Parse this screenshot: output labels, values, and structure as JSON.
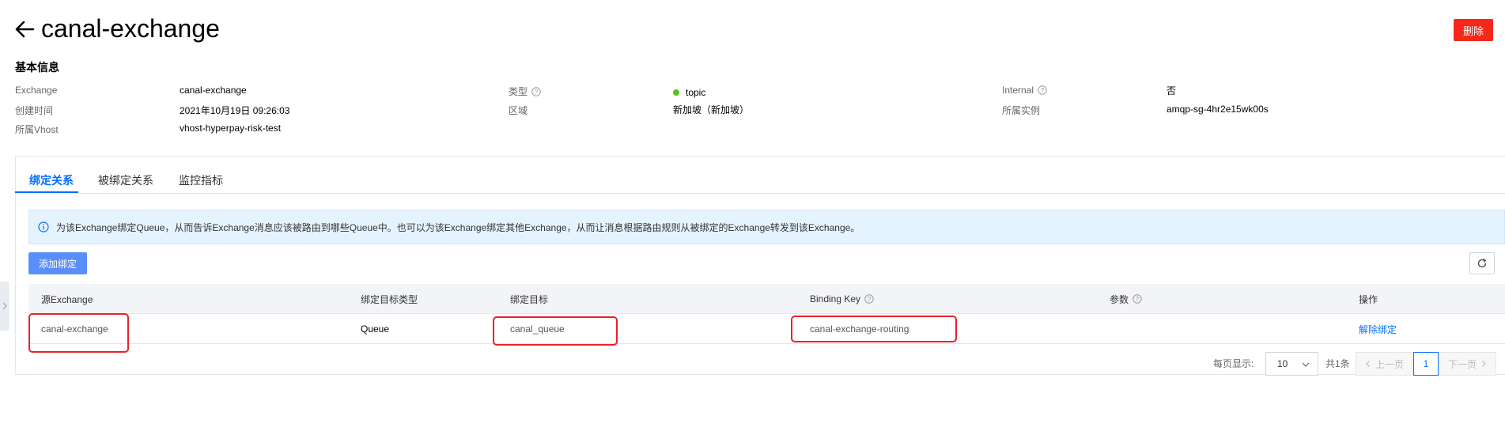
{
  "header": {
    "title": "canal-exchange",
    "delete_label": "删除"
  },
  "basic_info": {
    "section_title": "基本信息",
    "fields": [
      {
        "label": "Exchange",
        "value": "canal-exchange"
      },
      {
        "label": "创建时间",
        "value": "2021年10月19日 09:26:03"
      },
      {
        "label": "所属Vhost",
        "value": "vhost-hyperpay-risk-test"
      },
      {
        "label": "类型",
        "value": "topic",
        "status_color": "#52c41a"
      },
      {
        "label": "区域",
        "value": "新加坡（新加坡）"
      },
      {
        "label": "Internal",
        "value": "否"
      },
      {
        "label": "所属实例",
        "value": "amqp-sg-4hr2e15wk00s"
      }
    ]
  },
  "tabs": [
    {
      "label": "绑定关系",
      "active": true
    },
    {
      "label": "被绑定关系",
      "active": false
    },
    {
      "label": "监控指标",
      "active": false
    }
  ],
  "notice": {
    "icon": "info-icon",
    "text": "为该Exchange绑定Queue，从而告诉Exchange消息应该被路由到哪些Queue中。也可以为该Exchange绑定其他Exchange，从而让消息根据路由规则从被绑定的Exchange转发到该Exchange。"
  },
  "toolbar": {
    "add_label": "添加绑定",
    "refresh_icon": "refresh-icon"
  },
  "table": {
    "columns": [
      "源Exchange",
      "绑定目标类型",
      "绑定目标",
      "Binding Key",
      "参数",
      "操作"
    ],
    "rows": [
      {
        "source": "canal-exchange",
        "target_type": "Queue",
        "target": "canal_queue",
        "binding_key": "canal-exchange-routing",
        "params": "",
        "action": "解除绑定"
      }
    ]
  },
  "pagination": {
    "page_size_label": "每页显示:",
    "page_size": "10",
    "total": "共1条",
    "prev": "上一页",
    "current_page": "1",
    "next": "下一页"
  },
  "colors": {
    "accent": "#006eff",
    "danger": "#f5281b",
    "primary_button": "#5a8ffb",
    "highlight_box": "#e8222a"
  }
}
